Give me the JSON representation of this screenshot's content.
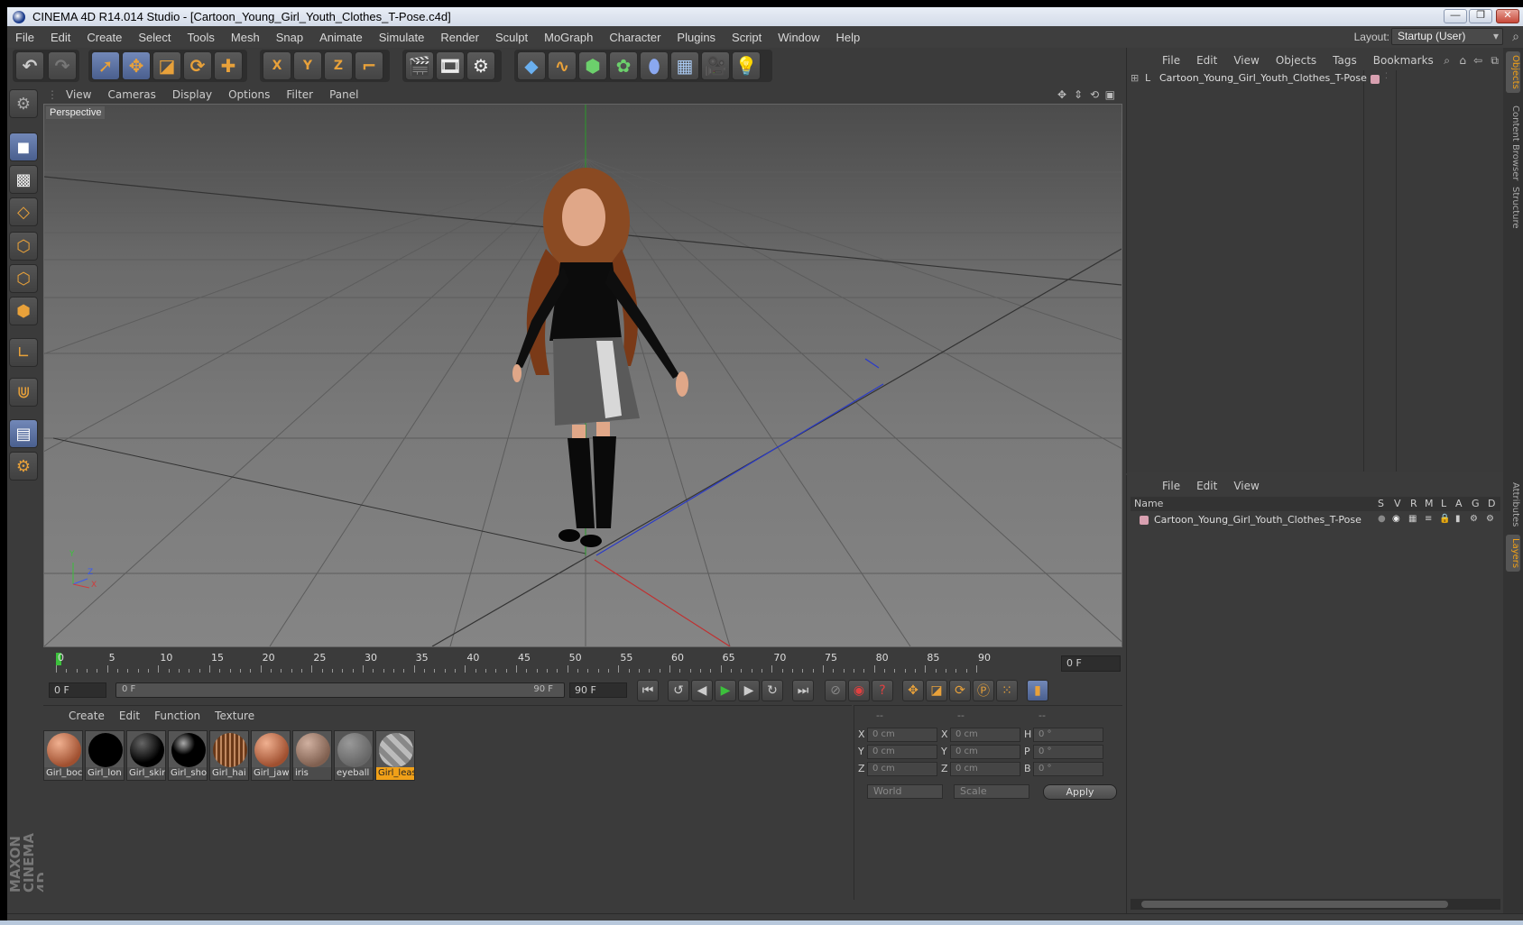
{
  "window": {
    "title": "CINEMA 4D R14.014 Studio - [Cartoon_Young_Girl_Youth_Clothes_T-Pose.c4d]",
    "minimize": "—",
    "restore": "❐",
    "close": "✕"
  },
  "menubar": {
    "items": [
      "File",
      "Edit",
      "Create",
      "Select",
      "Tools",
      "Mesh",
      "Snap",
      "Animate",
      "Simulate",
      "Render",
      "Sculpt",
      "MoGraph",
      "Character",
      "Plugins",
      "Script",
      "Window",
      "Help"
    ],
    "layout_label": "Layout:",
    "layout_value": "Startup (User)"
  },
  "toolbar": {
    "undo": "↶",
    "redo": "↷",
    "axis_x": "X",
    "axis_y": "Y",
    "axis_z": "Z"
  },
  "viewport": {
    "menu": [
      "View",
      "Cameras",
      "Display",
      "Options",
      "Filter",
      "Panel"
    ],
    "label": "Perspective",
    "axis_y": "Y",
    "axis_z": "Z",
    "axis_x": "X"
  },
  "timeline": {
    "ticks": [
      "0",
      "5",
      "10",
      "15",
      "20",
      "25",
      "30",
      "35",
      "40",
      "45",
      "50",
      "55",
      "60",
      "65",
      "70",
      "75",
      "80",
      "85",
      "90"
    ],
    "current_frame": "0 F"
  },
  "transport": {
    "start_field": "0 F",
    "range_start": "0 F",
    "range_end": "90 F",
    "end_field": "90 F"
  },
  "materials": {
    "menu": [
      "Create",
      "Edit",
      "Function",
      "Texture"
    ],
    "items": [
      {
        "label": "Girl_boc",
        "color": "#c07050"
      },
      {
        "label": "Girl_lon",
        "color": "#000000"
      },
      {
        "label": "Girl_skir",
        "color": "#111111"
      },
      {
        "label": "Girl_sho",
        "color": "#050505"
      },
      {
        "label": "Girl_hai",
        "color": "#8a5030"
      },
      {
        "label": "Girl_jaw",
        "color": "#c07050"
      },
      {
        "label": "iris",
        "color": "#a08070"
      },
      {
        "label": "eyeball",
        "color": "#8a8a8a"
      },
      {
        "label": "Girl_leas",
        "color": "#9a9a9a"
      }
    ]
  },
  "coordinates": {
    "header": [
      "--",
      "--",
      "--"
    ],
    "rows": [
      {
        "l1": "X",
        "v1": "0 cm",
        "l2": "X",
        "v2": "0 cm",
        "l3": "H",
        "v3": "0 °"
      },
      {
        "l1": "Y",
        "v1": "0 cm",
        "l2": "Y",
        "v2": "0 cm",
        "l3": "P",
        "v3": "0 °"
      },
      {
        "l1": "Z",
        "v1": "0 cm",
        "l2": "Z",
        "v2": "0 cm",
        "l3": "B",
        "v3": "0 °"
      }
    ],
    "mode": "World",
    "transform": "Scale",
    "apply": "Apply"
  },
  "object_manager": {
    "menu": [
      "File",
      "Edit",
      "View",
      "Objects",
      "Tags",
      "Bookmarks"
    ],
    "object": "Cartoon_Young_Girl_Youth_Clothes_T-Pose"
  },
  "layer_manager": {
    "menu": [
      "File",
      "Edit",
      "View"
    ],
    "columns": [
      "Name",
      "S",
      "V",
      "R",
      "M",
      "L",
      "A",
      "G",
      "D"
    ],
    "object": "Cartoon_Young_Girl_Youth_Clothes_T-Pose"
  },
  "side_tabs": [
    "Objects",
    "Content Browser",
    "Structure",
    "Attributes",
    "Layers"
  ],
  "brand": "MAXON CINEMA 4D",
  "colors": {
    "accent": "#f0a018",
    "selected": "#5a6f9e"
  }
}
